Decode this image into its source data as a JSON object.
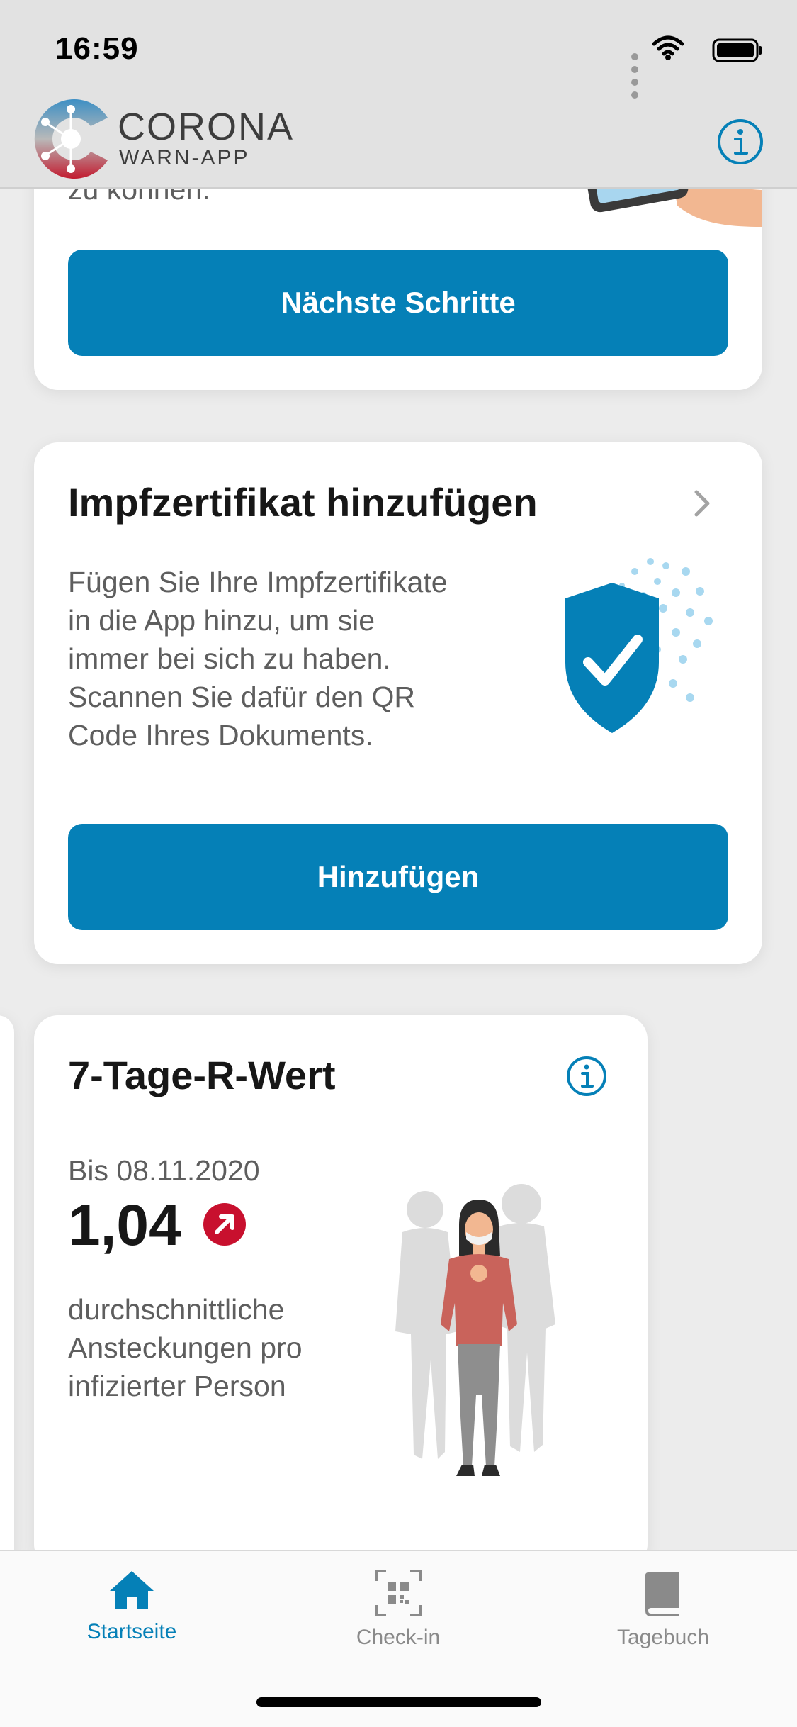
{
  "status_bar": {
    "time": "16:59"
  },
  "header": {
    "brand_line1": "CORONA",
    "brand_line2": "WARN-APP",
    "info_icon": "info-icon"
  },
  "card_next_steps": {
    "partial_text": "zu können.",
    "button_label": "Nächste Schritte"
  },
  "card_vaccination": {
    "title": "Impfzertifikat hinzufügen",
    "description": "Fügen Sie Ihre Impfzertifikate in die App hinzu, um sie immer bei sich zu haben. Scannen Sie dafür den QR Code Ihres Dokuments.",
    "button_label": "Hinzufügen"
  },
  "card_r_value": {
    "title": "7-Tage-R-Wert",
    "date": "Bis 08.11.2020",
    "value": "1,04",
    "trend": "up",
    "description": "durchschnittliche Ansteckungen pro infizierter Person"
  },
  "tabbar": {
    "items": [
      {
        "label": "Startseite",
        "icon": "home-icon",
        "active": true
      },
      {
        "label": "Check-in",
        "icon": "qr-code-icon",
        "active": false
      },
      {
        "label": "Tagebuch",
        "icon": "book-icon",
        "active": false
      }
    ]
  },
  "colors": {
    "accent": "#0580b7",
    "trend_up": "#c8102e",
    "background": "#ececec"
  }
}
